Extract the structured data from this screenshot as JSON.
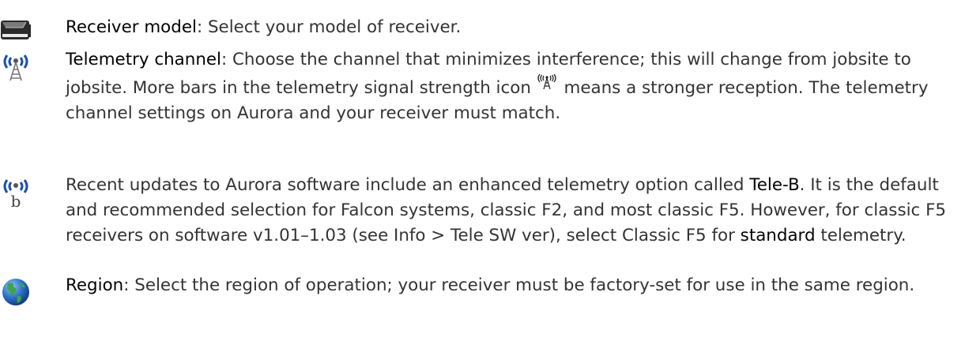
{
  "items": [
    {
      "icon": "receiver-icon",
      "term": "Receiver model",
      "text": ": Select your model of receiver."
    },
    {
      "icon": "telemetry-antenna-icon",
      "term": "Telemetry channel",
      "text_before_icon": ": Choose the channel that minimizes interference; this will change from jobsite to jobsite. More bars in the telemetry signal strength icon ",
      "inline_icon": "telemetry-signal-strength-icon",
      "text_after_icon": " means a stronger reception. The telemetry channel settings on Aurora and your receiver must match."
    },
    {
      "icon": "tele-b-icon",
      "text_before": "Recent updates to Aurora software include an enhanced telemetry option called ",
      "term": "Tele-B",
      "text_middle": ". It is the default and recommended selection for Falcon systems, classic F2, and most classic F5. However, for classic F5 receivers on software v1.01–1.03 (see Info > Tele SW ver), select Classic F5 for ",
      "emphasis": "standard",
      "text_after": " telemetry."
    },
    {
      "icon": "globe-icon",
      "term": "Region",
      "text": ": Select the region of operation; your receiver must be factory-set for use in the same region."
    }
  ],
  "colors": {
    "text": "#333333",
    "term": "#000000",
    "icon_blue": "#1a4fb0",
    "globe_blue": "#2b6fc2",
    "globe_green": "#3fa34d"
  }
}
